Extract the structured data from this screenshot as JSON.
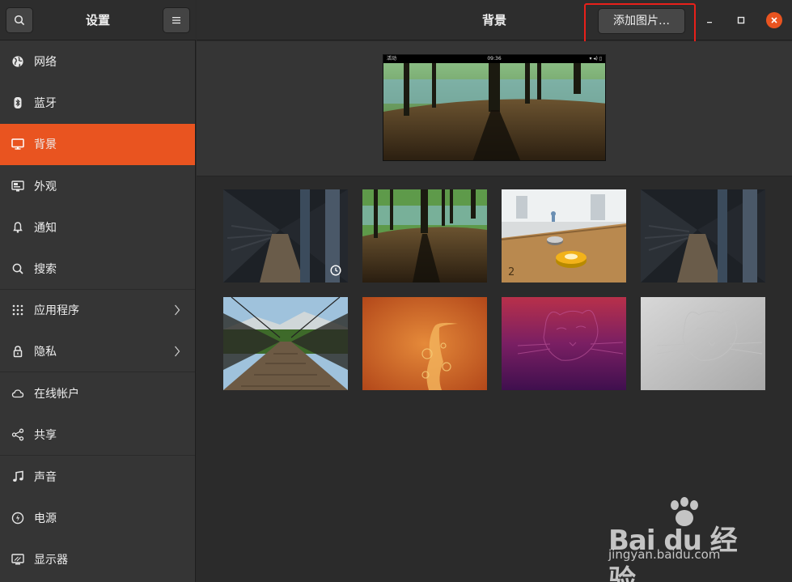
{
  "sidebar": {
    "title": "设置",
    "items": [
      {
        "label": "网络",
        "icon": "globe-icon"
      },
      {
        "label": "蓝牙",
        "icon": "bluetooth-icon"
      },
      {
        "label": "背景",
        "icon": "monitor-icon",
        "active": true
      },
      {
        "label": "外观",
        "icon": "appearance-icon"
      },
      {
        "label": "通知",
        "icon": "bell-icon"
      },
      {
        "label": "搜索",
        "icon": "search-icon"
      },
      {
        "label": "应用程序",
        "icon": "apps-grid-icon",
        "has_submenu": true
      },
      {
        "label": "隐私",
        "icon": "lock-icon",
        "has_submenu": true
      },
      {
        "label": "在线帐户",
        "icon": "cloud-icon"
      },
      {
        "label": "共享",
        "icon": "share-icon"
      },
      {
        "label": "声音",
        "icon": "music-note-icon"
      },
      {
        "label": "电源",
        "icon": "power-icon"
      },
      {
        "label": "显示器",
        "icon": "display-icon"
      }
    ]
  },
  "header": {
    "title": "背景",
    "add_button": "添加图片…"
  },
  "preview": {
    "activities": "活动",
    "clock": "09:36"
  },
  "wallpapers": [
    {
      "name": "subway-platform-wallpaper",
      "timed": true
    },
    {
      "name": "forest-shadow-wallpaper"
    },
    {
      "name": "shuffleboard-wallpaper"
    },
    {
      "name": "subway-platform-wallpaper-2"
    },
    {
      "name": "suspension-bridge-wallpaper"
    },
    {
      "name": "orange-heron-wallpaper"
    },
    {
      "name": "purple-fossa-wallpaper"
    },
    {
      "name": "grey-fossa-wallpaper"
    }
  ],
  "watermark": {
    "brand": "Bai du 经验",
    "url": "jingyan.baidu.com"
  },
  "colors": {
    "accent": "#e95420",
    "sidebar_bg": "#353535",
    "main_bg": "#2b2b2b",
    "highlight_box": "#e8201a"
  }
}
